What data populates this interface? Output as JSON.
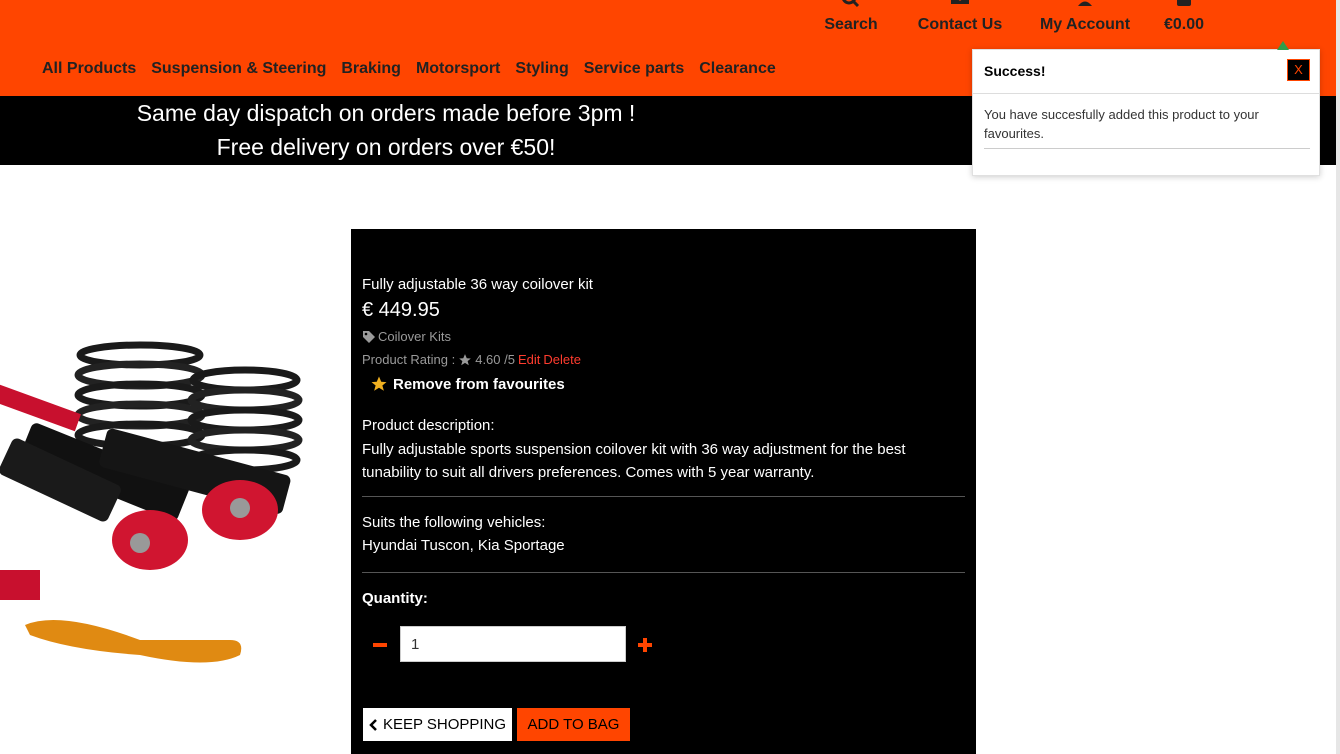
{
  "header": {
    "search_label": "Search",
    "contact_label": "Contact Us",
    "account_label": "My Account",
    "bag_total": "€0.00"
  },
  "nav": {
    "items": [
      "All Products",
      "Suspension & Steering",
      "Braking",
      "Motorsport",
      "Styling",
      "Service parts",
      "Clearance"
    ]
  },
  "banner": {
    "line1": "Same day dispatch on orders made before 3pm !",
    "line2": "Free delivery on orders over €50!"
  },
  "product": {
    "name": "Fully adjustable 36 way coilover kit",
    "price": "€ 449.95",
    "category": "Coilover Kits",
    "rating_label": "Product Rating :",
    "rating_value": "4.60 /5",
    "edit_label": "Edit",
    "delete_label": "Delete",
    "favourite_label": "Remove from favourites",
    "description_heading": "Product description:",
    "description": "Fully adjustable sports suspension coilover kit with 36 way adjustment for the best tunability to suit all drivers preferences. Comes with 5 year warranty.",
    "suits_heading": "Suits the following vehicles:",
    "suits": "Hyundai Tuscon, Kia Sportage",
    "quantity_label": "Quantity:",
    "quantity_value": "1",
    "keep_shopping_label": "KEEP SHOPPING",
    "add_to_bag_label": "ADD TO BAG"
  },
  "toast": {
    "title": "Success!",
    "close_label": "X",
    "message": "You have succesfully added this product to your favourites."
  },
  "colors": {
    "brand": "#ff4500",
    "panel": "#000000",
    "accent_red": "#ff3c2e",
    "star": "#f0b020"
  }
}
